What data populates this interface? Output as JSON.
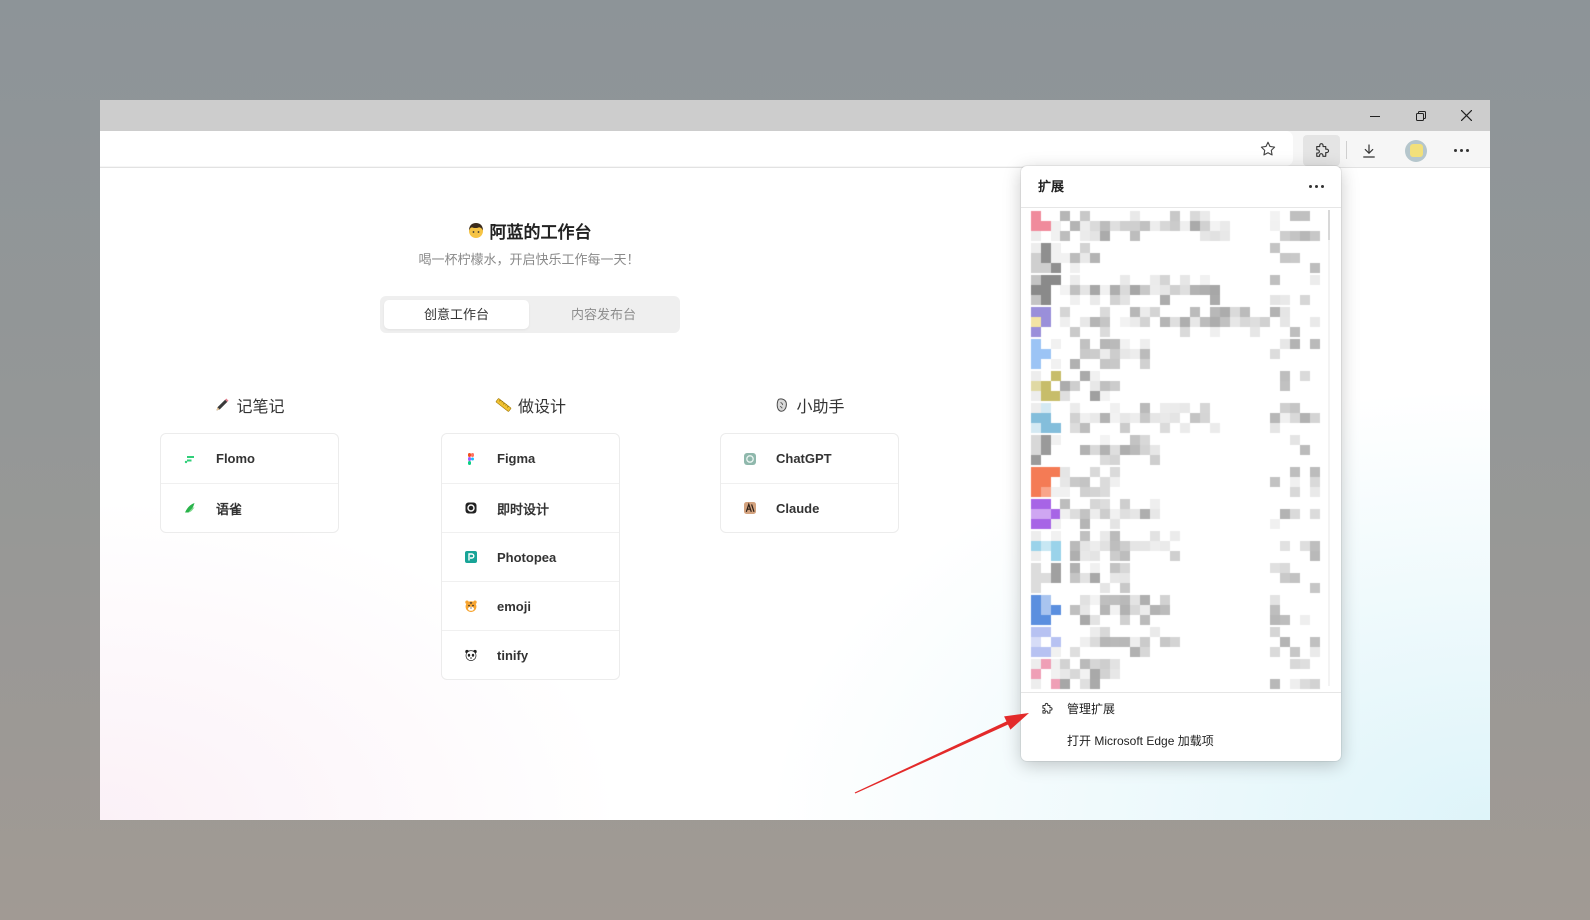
{
  "browser": {
    "title_bar": {
      "minimize_icon": "minimize-icon",
      "restore_icon": "restore-icon",
      "close_icon": "close-icon"
    },
    "toolbar": {
      "favorite_icon": "star-icon",
      "extensions_icon": "puzzle-icon",
      "downloads_icon": "download-icon",
      "profile_icon": "avatar",
      "menu_icon": "more-icon"
    }
  },
  "page": {
    "header": {
      "icon": "person-emoji-icon",
      "title": "阿蓝的工作台",
      "subtitle": "喝一杯柠檬水，开启快乐工作每一天！"
    },
    "tabs": [
      {
        "label": "创意工作台",
        "active": true
      },
      {
        "label": "内容发布台",
        "active": false
      }
    ],
    "sections": [
      {
        "title": "记笔记",
        "icon": "pencil-icon",
        "items": [
          {
            "label": "Flomo",
            "icon": "flomo-icon"
          },
          {
            "label": "语雀",
            "icon": "yuque-icon"
          }
        ]
      },
      {
        "title": "做设计",
        "icon": "ruler-icon",
        "items": [
          {
            "label": "Figma",
            "icon": "figma-icon"
          },
          {
            "label": "即时设计",
            "icon": "jishi-design-icon"
          },
          {
            "label": "Photopea",
            "icon": "photopea-icon"
          },
          {
            "label": "emoji",
            "icon": "tiger-emoji-icon"
          },
          {
            "label": "tinify",
            "icon": "panda-icon"
          }
        ]
      },
      {
        "title": "小助手",
        "icon": "assistant-icon",
        "items": [
          {
            "label": "ChatGPT",
            "icon": "chatgpt-icon"
          },
          {
            "label": "Claude",
            "icon": "claude-icon"
          }
        ]
      }
    ]
  },
  "extensions_popup": {
    "title": "扩展",
    "menu_icon": "more-icon",
    "manage_icon": "puzzle-icon",
    "manage_label": "管理扩展",
    "addons_label": "打开 Microsoft Edge 加载项"
  },
  "colors": {
    "annotation_arrow": "#e32a2a",
    "active_tab_bg": "#ffffff",
    "extensions_button_bg": "#e4e4e4"
  }
}
